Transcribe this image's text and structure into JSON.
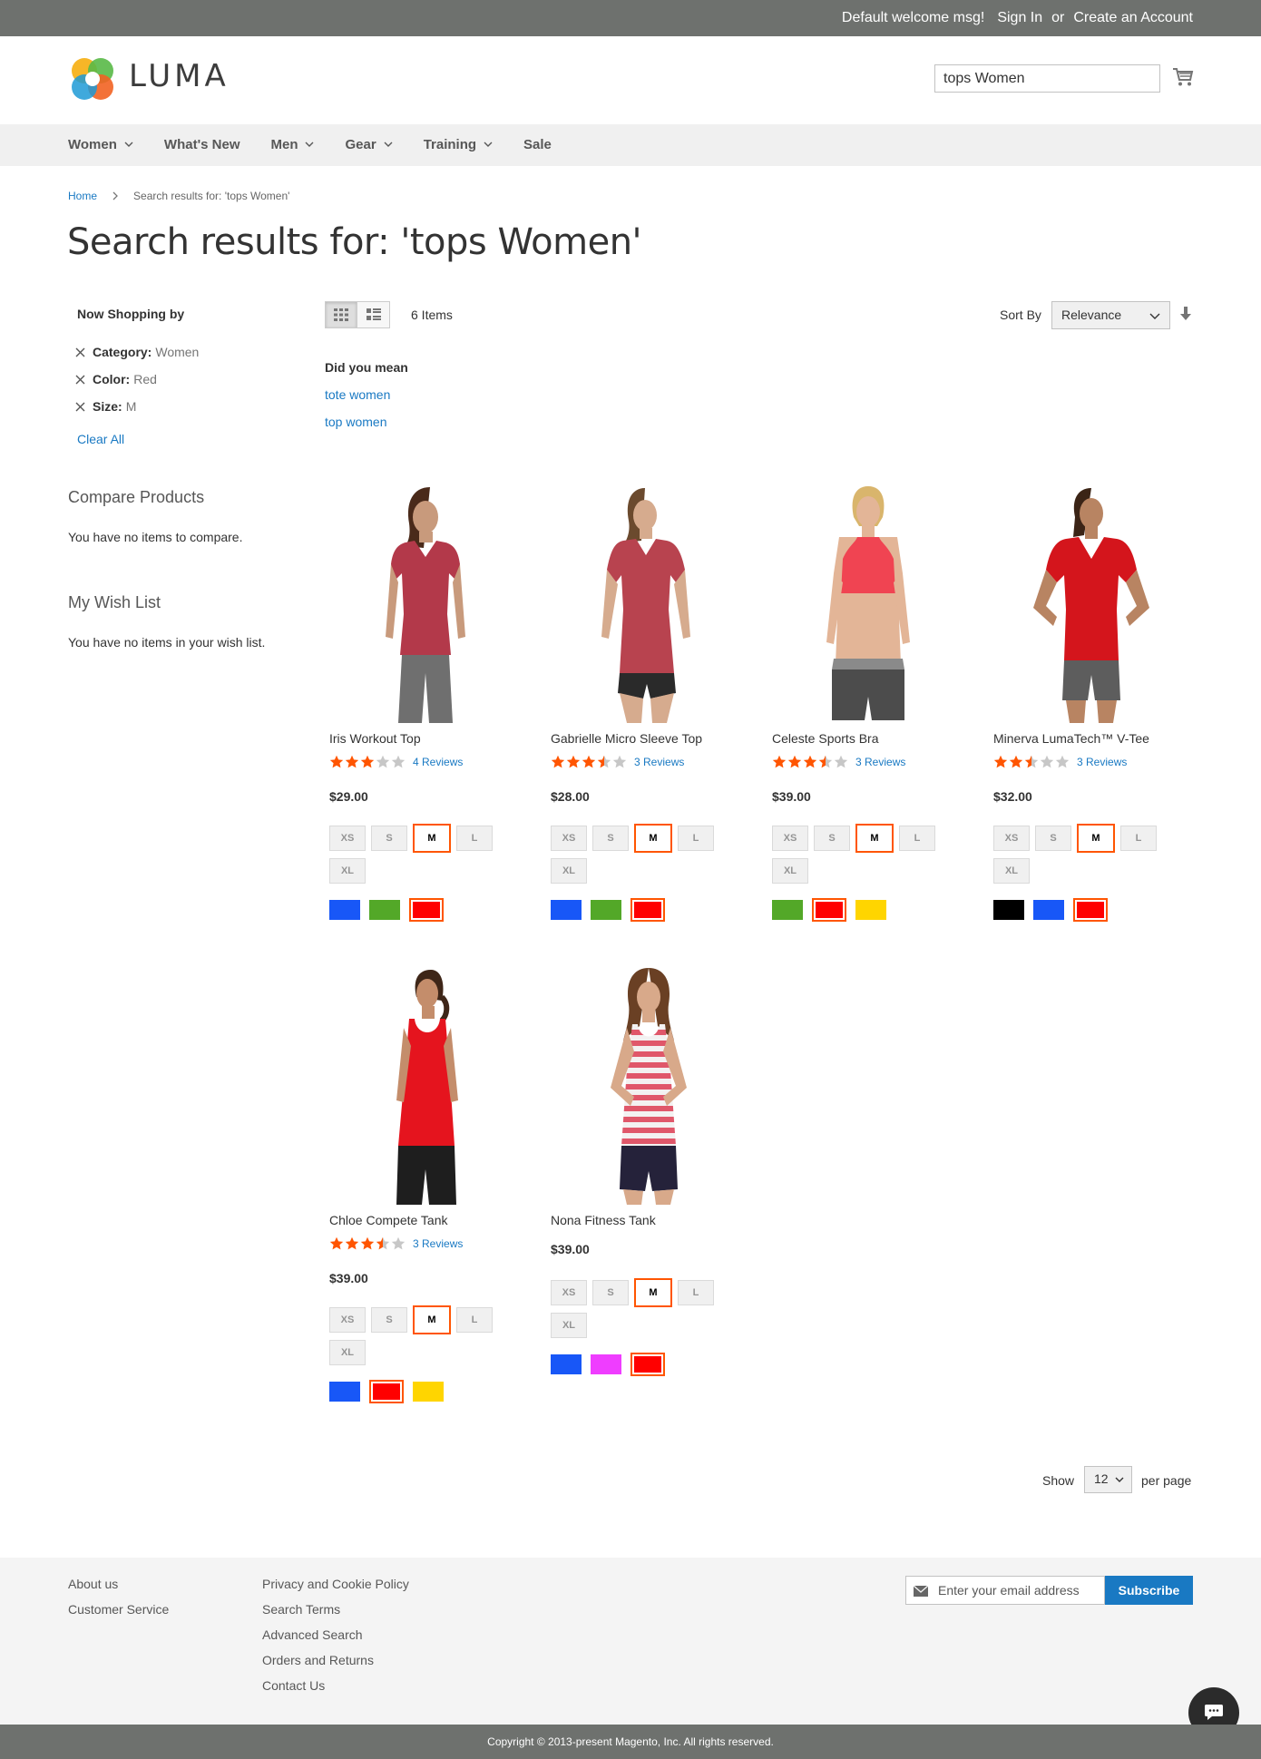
{
  "header": {
    "welcome": "Default welcome msg!",
    "sign_in": "Sign In",
    "or": "or",
    "create_account": "Create an Account",
    "logo_text": "LUMA",
    "search_value": "tops Women"
  },
  "nav": {
    "items": [
      {
        "label": "Women",
        "dropdown": true
      },
      {
        "label": "What's New",
        "dropdown": false
      },
      {
        "label": "Men",
        "dropdown": true
      },
      {
        "label": "Gear",
        "dropdown": true
      },
      {
        "label": "Training",
        "dropdown": true
      },
      {
        "label": "Sale",
        "dropdown": false
      }
    ]
  },
  "breadcrumb": {
    "home": "Home",
    "current": "Search results for: 'tops Women'"
  },
  "page_title": "Search results for: 'tops Women'",
  "sidebar": {
    "now_shopping": "Now Shopping by",
    "filters": [
      {
        "label": "Category:",
        "value": "Women"
      },
      {
        "label": "Color:",
        "value": "Red"
      },
      {
        "label": "Size:",
        "value": "M"
      }
    ],
    "clear_all": "Clear All",
    "compare_title": "Compare Products",
    "compare_text": "You have no items to compare.",
    "wishlist_title": "My Wish List",
    "wishlist_text": "You have no items in your wish list."
  },
  "toolbar": {
    "amount": "6 Items",
    "sort_label": "Sort By",
    "sort_value": "Relevance"
  },
  "did_you_mean": {
    "title": "Did you mean",
    "suggestions": [
      "tote women",
      "top women"
    ]
  },
  "colors": {
    "accent": "#1979c3",
    "selected_border": "#ff5501",
    "star_on": "#ff5501",
    "star_off": "#c7c7c7",
    "blue": "#1857f7",
    "green": "#53a828",
    "red": "#ff0000",
    "yellow": "#ffd500",
    "black": "#000000",
    "purple": "#ef3dff"
  },
  "products": [
    {
      "name": "Iris Workout Top",
      "rating_pct": 60,
      "reviews": "4  Reviews",
      "price": "$29.00",
      "sizes": [
        "XS",
        "S",
        "M",
        "L",
        "XL"
      ],
      "selected_size": "M",
      "swatches": [
        "blue",
        "green",
        "red"
      ],
      "selected_swatch": "red"
    },
    {
      "name": "Gabrielle Micro Sleeve Top",
      "rating_pct": 70,
      "reviews": "3  Reviews",
      "price": "$28.00",
      "sizes": [
        "XS",
        "S",
        "M",
        "L",
        "XL"
      ],
      "selected_size": "M",
      "swatches": [
        "blue",
        "green",
        "red"
      ],
      "selected_swatch": "red"
    },
    {
      "name": "Celeste Sports Bra",
      "rating_pct": 70,
      "reviews": "3  Reviews",
      "price": "$39.00",
      "sizes": [
        "XS",
        "S",
        "M",
        "L",
        "XL"
      ],
      "selected_size": "M",
      "swatches": [
        "green",
        "red",
        "yellow"
      ],
      "selected_swatch": "red"
    },
    {
      "name": "Minerva LumaTech™ V-Tee",
      "rating_pct": 50,
      "reviews": "3  Reviews",
      "price": "$32.00",
      "sizes": [
        "XS",
        "S",
        "M",
        "L",
        "XL"
      ],
      "selected_size": "M",
      "swatches": [
        "black",
        "blue",
        "red"
      ],
      "selected_swatch": "red"
    },
    {
      "name": "Chloe Compete Tank",
      "rating_pct": 70,
      "reviews": "3  Reviews",
      "price": "$39.00",
      "sizes": [
        "XS",
        "S",
        "M",
        "L",
        "XL"
      ],
      "selected_size": "M",
      "swatches": [
        "blue",
        "red",
        "yellow"
      ],
      "selected_swatch": "red"
    },
    {
      "name": "Nona Fitness Tank",
      "rating_pct": null,
      "reviews": "",
      "price": "$39.00",
      "sizes": [
        "XS",
        "S",
        "M",
        "L",
        "XL"
      ],
      "selected_size": "M",
      "swatches": [
        "blue",
        "purple",
        "red"
      ],
      "selected_swatch": "red"
    }
  ],
  "pager": {
    "show": "Show",
    "limit": "12",
    "per_page": "per page"
  },
  "footer": {
    "col1": [
      "About us",
      "Customer Service"
    ],
    "col2": [
      "Privacy and Cookie Policy",
      "Search Terms",
      "Advanced Search",
      "Orders and Returns",
      "Contact Us"
    ],
    "newsletter_placeholder": "Enter your email address",
    "subscribe": "Subscribe",
    "copyright": "Copyright © 2013-present Magento, Inc. All rights reserved."
  }
}
